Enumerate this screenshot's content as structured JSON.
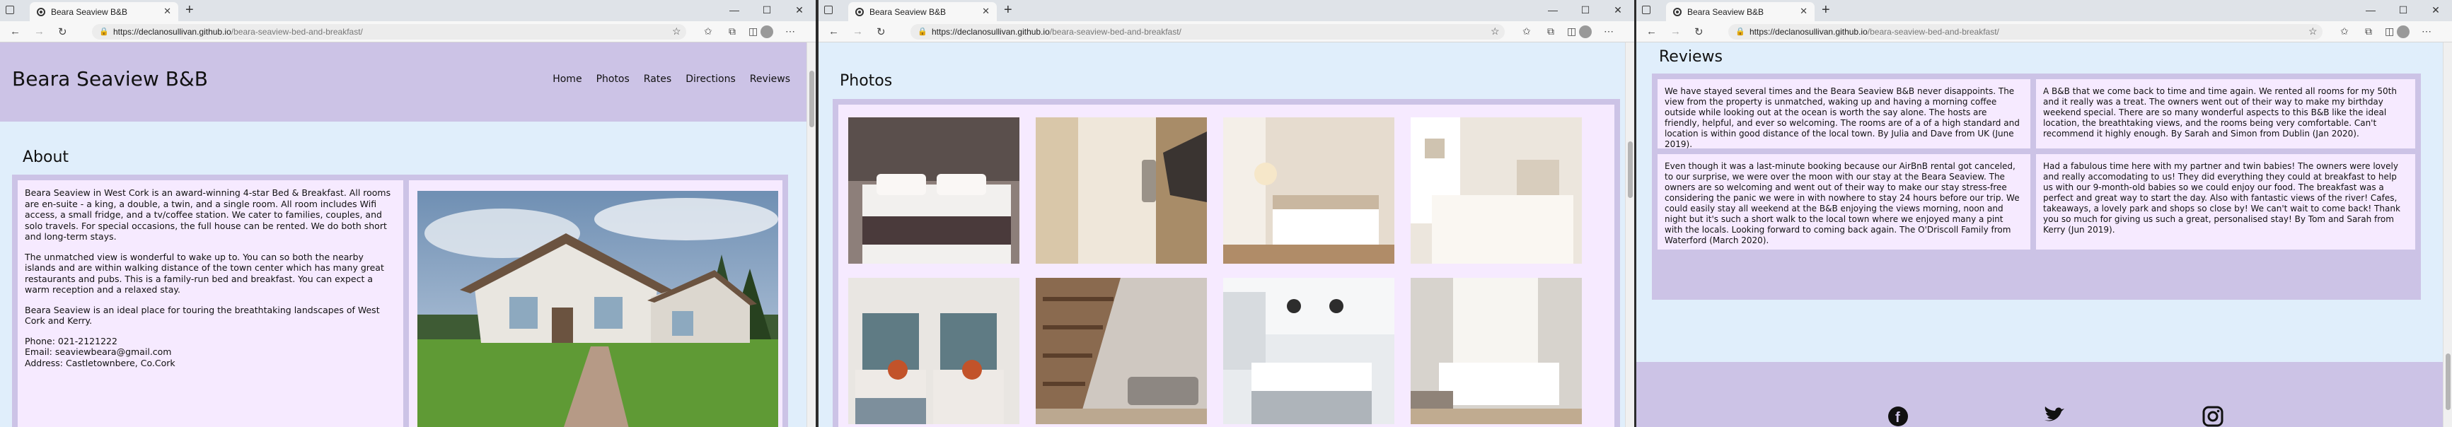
{
  "browser": {
    "tab_title": "Beara Seaview B&B",
    "url_host": "https://declanosullivan.github.io",
    "url_path": "/beara-seaview-bed-and-breakfast/"
  },
  "site": {
    "brand": "Beara Seaview B&B",
    "nav": [
      "Home",
      "Photos",
      "Rates",
      "Directions",
      "Reviews"
    ]
  },
  "about": {
    "title": "About",
    "p1": "Beara Seaview in West Cork is an award-winning 4-star Bed & Breakfast. All rooms are en-suite - a king, a double, a twin, and a single room. All room includes Wifi access, a small fridge, and a tv/coffee station. We cater to families, couples, and solo travels. For special occasions, the full house can be rented. We do both short and long-term stays.",
    "p2": "The unmatched view is wonderful to wake up to. You can so both the nearby islands and are within walking distance of the town center which has many great restaurants and pubs. This is a family-run bed and breakfast. You can expect a warm reception and a relaxed stay.",
    "p3": "Beara Seaview is an ideal place for touring the breathtaking landscapes of West Cork and Kerry.",
    "phone": "Phone: 021-2121222",
    "email": "Email: seaviewbeara@gmail.com",
    "address": "Address: Castletownbere, Co.Cork"
  },
  "photos": {
    "title": "Photos",
    "items": [
      "bedroom-dark-throw",
      "door-keycard",
      "bright-bedroom-lamp",
      "white-bed-window",
      "twin-beds-orange-pillows",
      "living-room-staircase",
      "white-kitchen-island",
      "bedroom-desk-window"
    ]
  },
  "reviews": {
    "title": "Reviews",
    "items": [
      "We have stayed several times and the Beara Seaview B&B never disappoints. The view from the property is unmatched, waking up and having a morning coffee outside while looking out at the ocean is worth the say alone. The hosts are friendly, helpful, and ever so welcoming. The rooms are of a of a high standard and location is within good distance of the local town. By Julia and Dave from UK (June 2019).",
      "A B&B that we come back to time and time again. We rented all rooms for my 50th and it really was a treat. The owners went out of their way to make my birthday weekend special. There are so many wonderful aspects to this B&B like the ideal location, the breathtaking views, and the rooms being very comfortable. Can't recommend it highly enough. By Sarah and Simon from Dublin (Jan 2020).",
      "Even though it was a last-minute booking because our AirBnB rental got canceled, to our surprise, we were over the moon with our stay at the Beara Seaview. The owners are so welcoming and went out of their way to make our stay stress-free considering the panic we were in with nowhere to stay 24 hours before our trip. We could easily stay all weekend at the B&B enjoying the views morning, noon and night but it's such a short walk to the local town where we enjoyed many a pint with the locals. Looking forward to coming back again. The O'Driscoll Family from Waterford (March 2020).",
      "Had a fabulous time here with my partner and twin babies! The owners were lovely and really accomodating to us! They did everything they could at breakfast to help us with our 9-month-old babies so we could enjoy our food. The breakfast was a perfect and great way to start the day. Also with fantastic views of the river! Cafes, takeaways, a lovely park and shops so close by! We can't wait to come back! Thank you so much for giving us such a great, personalised stay! By Tom and Sarah from Kerry (Jun 2019)."
    ]
  },
  "footer": {
    "icons": [
      "facebook-icon",
      "twitter-icon",
      "instagram-icon"
    ]
  },
  "colors": {
    "header_bg": "#ccc3e6",
    "card_bg": "#f6eaff",
    "page_bg": "#e0eefb"
  }
}
